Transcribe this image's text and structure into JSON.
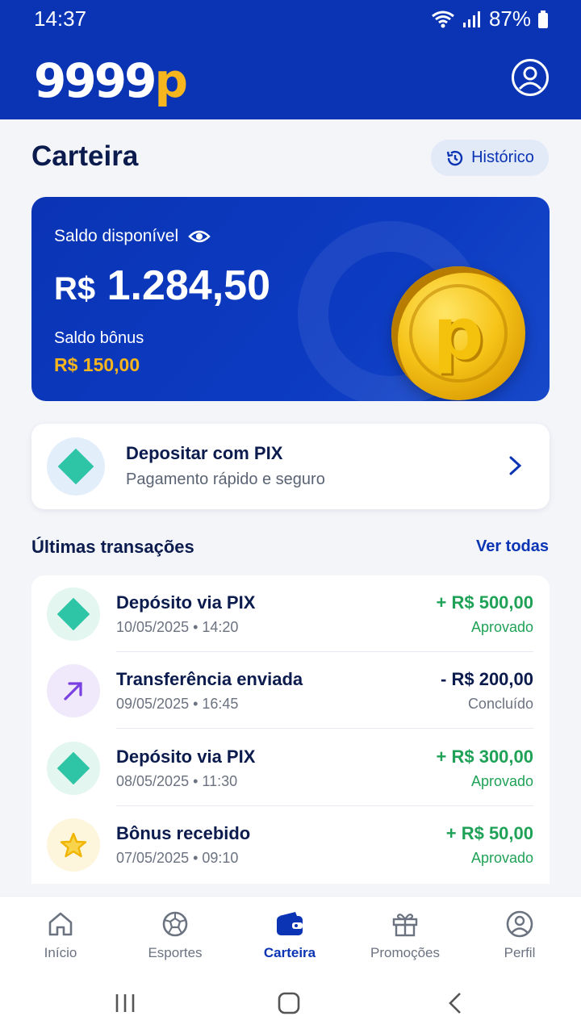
{
  "status_bar": {
    "time": "14:37",
    "battery": "87%"
  },
  "header": {
    "logo_main": "9999",
    "logo_accent": "p"
  },
  "page": {
    "title": "Carteira",
    "history_label": "Histórico"
  },
  "balance": {
    "label": "Saldo disponível",
    "currency": "R$",
    "amount": "1.284,50",
    "bonus_label": "Saldo bônus",
    "bonus_value": "R$ 150,00",
    "coin_letter": "p"
  },
  "pix": {
    "title": "Depositar com PIX",
    "subtitle": "Pagamento rápido e seguro"
  },
  "transactions": {
    "section_title": "Últimas transações",
    "see_all": "Ver todas",
    "items": [
      {
        "title": "Depósito via PIX",
        "date": "10/05/2025 • 14:20",
        "amount": "+ R$ 500,00",
        "status": "Aprovado",
        "icon": "pix-icon"
      },
      {
        "title": "Transferência enviada",
        "date": "09/05/2025 • 16:45",
        "amount": "- R$ 200,00",
        "status": "Concluído",
        "icon": "arrow-up-right-icon"
      },
      {
        "title": "Depósito via PIX",
        "date": "08/05/2025 • 11:30",
        "amount": "+ R$ 300,00",
        "status": "Aprovado",
        "icon": "pix-icon"
      },
      {
        "title": "Bônus recebido",
        "date": "07/05/2025 • 09:10",
        "amount": "+ R$ 50,00",
        "status": "Aprovado",
        "icon": "star-icon"
      }
    ]
  },
  "bottom_nav": [
    {
      "label": "Início",
      "icon": "home-icon"
    },
    {
      "label": "Esportes",
      "icon": "ball-icon"
    },
    {
      "label": "Carteira",
      "icon": "wallet-icon",
      "active": true
    },
    {
      "label": "Promoções",
      "icon": "gift-icon"
    },
    {
      "label": "Perfil",
      "icon": "profile-icon"
    }
  ],
  "colors": {
    "brand_blue": "#0a34b4",
    "accent_gold": "#f7b51e",
    "positive_green": "#1fa257"
  }
}
